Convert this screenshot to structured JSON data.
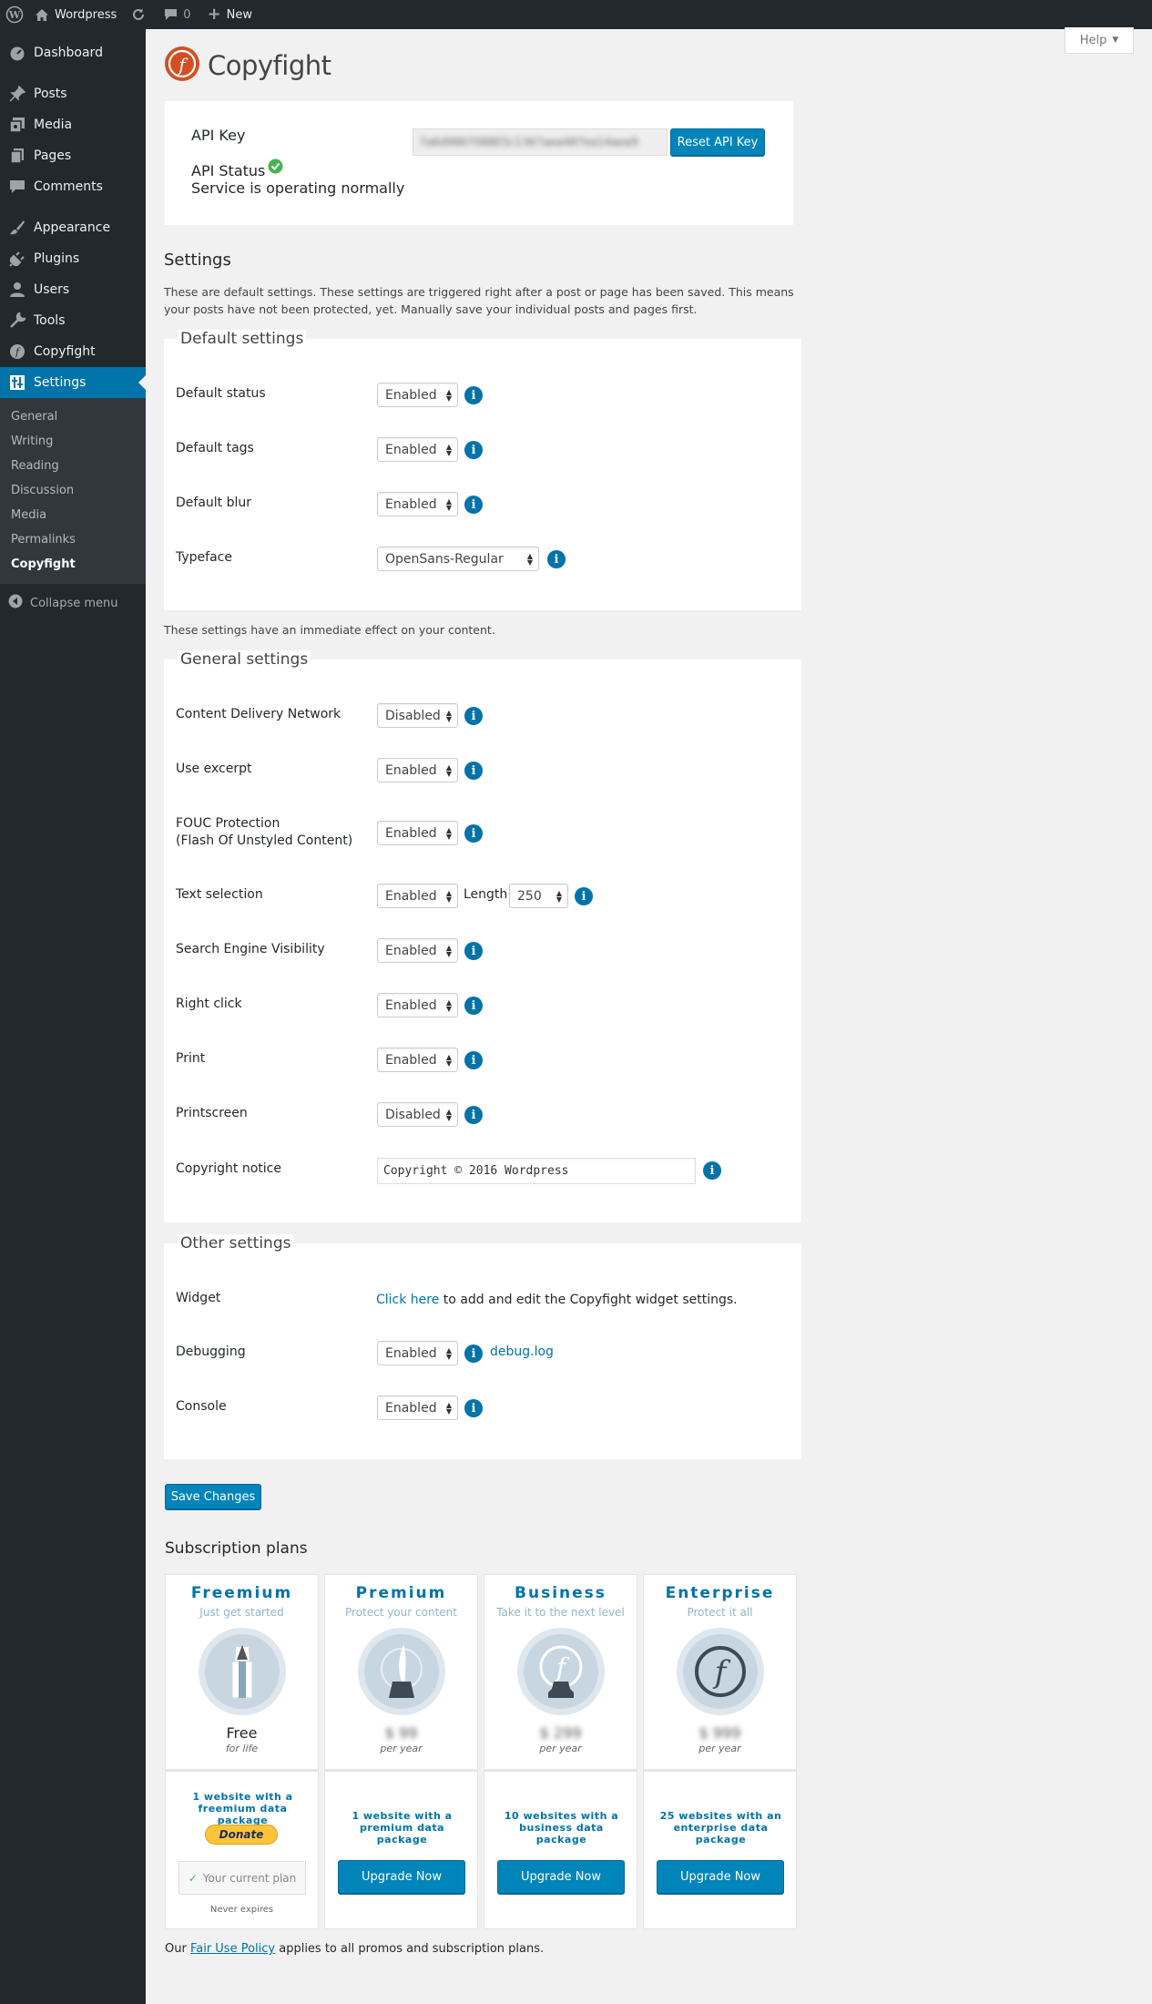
{
  "adminbar": {
    "site_name": "Wordpress",
    "comments_count": "0",
    "new_label": "New"
  },
  "sidebar": {
    "items": [
      {
        "label": "Dashboard",
        "icon": "dashboard-icon"
      },
      {
        "label": "Posts",
        "icon": "pin-icon"
      },
      {
        "label": "Media",
        "icon": "media-icon"
      },
      {
        "label": "Pages",
        "icon": "page-icon"
      },
      {
        "label": "Comments",
        "icon": "comment-icon"
      },
      {
        "label": "Appearance",
        "icon": "brush-icon"
      },
      {
        "label": "Plugins",
        "icon": "plug-icon"
      },
      {
        "label": "Users",
        "icon": "user-icon"
      },
      {
        "label": "Tools",
        "icon": "wrench-icon"
      },
      {
        "label": "Copyfight",
        "icon": "copyfight-icon"
      },
      {
        "label": "Settings",
        "icon": "settings-icon"
      }
    ],
    "submenu": [
      "General",
      "Writing",
      "Reading",
      "Discussion",
      "Media",
      "Permalinks",
      "Copyfight"
    ],
    "collapse": "Collapse menu"
  },
  "help": "Help",
  "logo_text": "Copyfight",
  "api": {
    "key_label": "API Key",
    "key_value": "7a6d9867088E5c1367aea487ea14aea9",
    "reset_button": "Reset API Key",
    "status_label": "API Status",
    "status_text": "Service is operating normally"
  },
  "settings": {
    "heading": "Settings",
    "desc": "These are default settings. These settings are triggered right after a post or page has been saved. This means your posts have not been protected, yet. Manually save your individual posts and pages first.",
    "default_legend": "Default settings",
    "default_rows": [
      {
        "label": "Default status",
        "value": "Enabled"
      },
      {
        "label": "Default tags",
        "value": "Enabled"
      },
      {
        "label": "Default blur",
        "value": "Enabled"
      },
      {
        "label": "Typeface",
        "value": "OpenSans-Regular"
      }
    ],
    "immediate_note": "These settings have an immediate effect on your content.",
    "general_legend": "General settings",
    "general_rows": [
      {
        "label": "Content Delivery Network",
        "value": "Disabled"
      },
      {
        "label": "Use excerpt",
        "value": "Enabled"
      },
      {
        "label": "FOUC Protection",
        "label2": "(Flash Of Unstyled Content)",
        "value": "Enabled"
      },
      {
        "label": "Text selection",
        "value": "Enabled",
        "length_label": "Length",
        "length_value": "250"
      },
      {
        "label": "Search Engine Visibility",
        "value": "Enabled"
      },
      {
        "label": "Right click",
        "value": "Enabled"
      },
      {
        "label": "Print",
        "value": "Enabled"
      },
      {
        "label": "Printscreen",
        "value": "Disabled"
      },
      {
        "label": "Copyright notice",
        "value": "Copyright © 2016 Wordpress"
      }
    ],
    "other_legend": "Other settings",
    "widget_label": "Widget",
    "widget_link": "Click here",
    "widget_text": " to add and edit the Copyfight widget settings.",
    "debug_label": "Debugging",
    "debug_value": "Enabled",
    "debug_link": "debug.log",
    "console_label": "Console",
    "console_value": "Enabled",
    "save_button": "Save Changes"
  },
  "plans": {
    "heading": "Subscription plans",
    "items": [
      {
        "name": "Freemium",
        "tag": "Just get started",
        "price": "Free",
        "per": "for life",
        "feature1": "1 website with a",
        "feature2": "freemium data package",
        "donate": "Donate",
        "current": "Your current plan",
        "expires": "Never expires"
      },
      {
        "name": "Premium",
        "tag": "Protect your content",
        "price": "$ 99",
        "per": "per year",
        "feature1": "1 website with a",
        "feature2": "premium data package",
        "button": "Upgrade Now"
      },
      {
        "name": "Business",
        "tag": "Take it to the next level",
        "price": "$ 299",
        "per": "per year",
        "feature1": "10 websites with a",
        "feature2": "business data package",
        "button": "Upgrade Now"
      },
      {
        "name": "Enterprise",
        "tag": "Protect it all",
        "price": "$ 999",
        "per": "per year",
        "feature1": "25 websites with an",
        "feature2": "enterprise data package",
        "button": "Upgrade Now"
      }
    ],
    "footer_pre": "Our ",
    "footer_link": "Fair Use Policy",
    "footer_post": " applies to all promos and subscription plans."
  },
  "colors": {
    "accent": "#0073aa",
    "sidebar": "#23282d",
    "primary_button": "#0085ba",
    "status_ok": "#46b450"
  }
}
